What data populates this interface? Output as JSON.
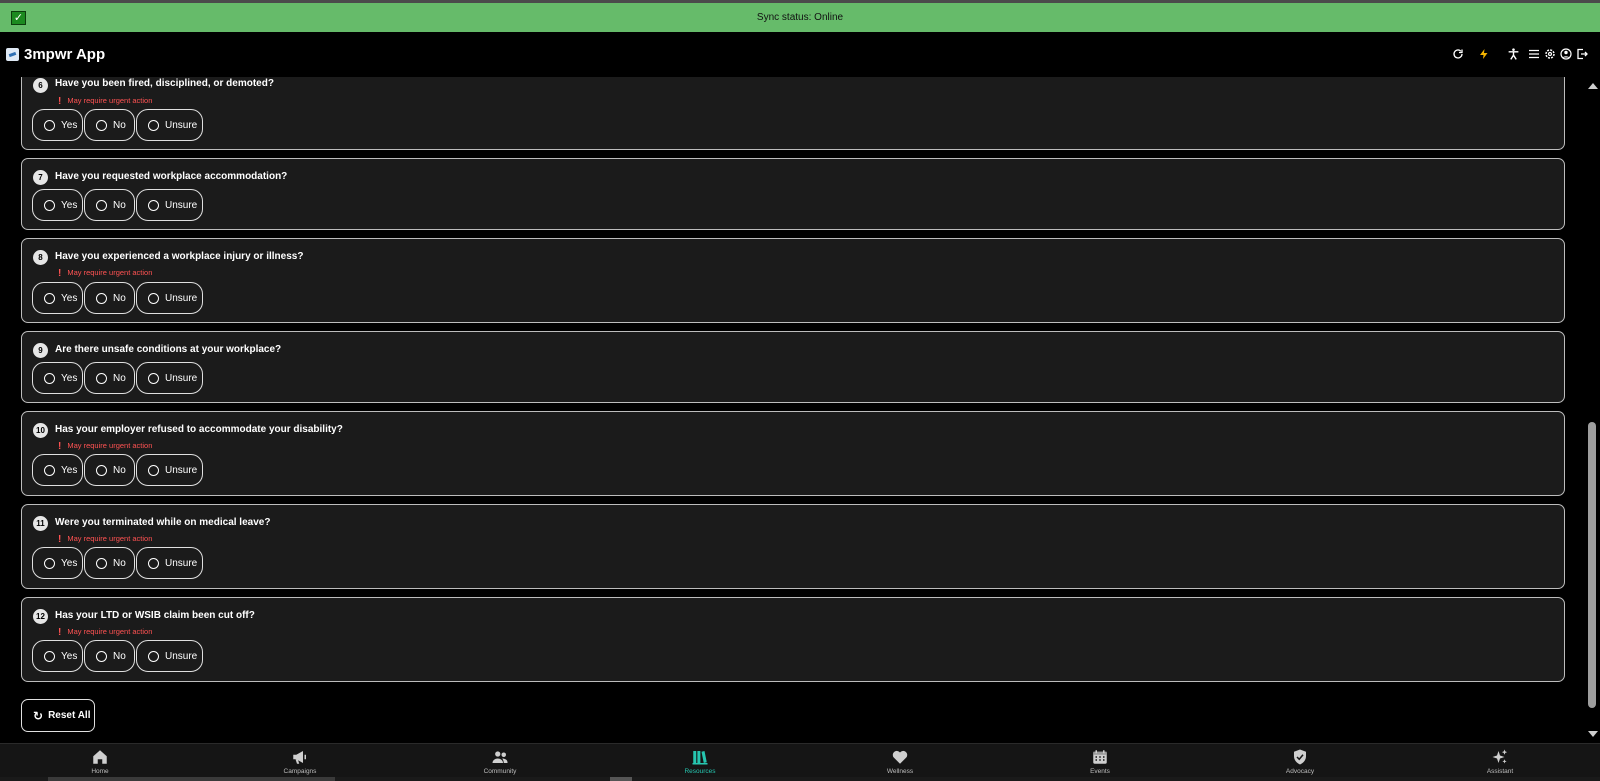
{
  "sync": {
    "status_text": "Sync status: Online"
  },
  "header": {
    "title": "3mpwr App",
    "icons": [
      "refresh-icon",
      "bolt-icon",
      "accessibility-icon",
      "menu-icon",
      "settings-icon",
      "account-icon",
      "logout-icon"
    ],
    "accent_color": "#f5b400"
  },
  "options": {
    "yes": "Yes",
    "no": "No",
    "unsure": "Unsure"
  },
  "urgent_label": "May require urgent action",
  "questions": [
    {
      "number": "6",
      "text": "Have you been fired, disciplined, or demoted?",
      "urgent": true
    },
    {
      "number": "7",
      "text": "Have you requested workplace accommodation?",
      "urgent": false
    },
    {
      "number": "8",
      "text": "Have you experienced a workplace injury or illness?",
      "urgent": true
    },
    {
      "number": "9",
      "text": "Are there unsafe conditions at your workplace?",
      "urgent": false
    },
    {
      "number": "10",
      "text": "Has your employer refused to accommodate your disability?",
      "urgent": true
    },
    {
      "number": "11",
      "text": "Were you terminated while on medical leave?",
      "urgent": true
    },
    {
      "number": "12",
      "text": "Has your LTD or WSIB claim been cut off?",
      "urgent": true
    }
  ],
  "reset": {
    "label": "Reset All"
  },
  "nav": {
    "active": "Resources",
    "active_color": "#26c6b0",
    "items": [
      {
        "label": "Home",
        "icon": "home-icon"
      },
      {
        "label": "Campaigns",
        "icon": "megaphone-icon"
      },
      {
        "label": "Community",
        "icon": "people-icon"
      },
      {
        "label": "Resources",
        "icon": "library-icon"
      },
      {
        "label": "Wellness",
        "icon": "heart-icon"
      },
      {
        "label": "Events",
        "icon": "calendar-icon"
      },
      {
        "label": "Advocacy",
        "icon": "shield-icon"
      },
      {
        "label": "Assistant",
        "icon": "sparkle-icon"
      }
    ]
  }
}
